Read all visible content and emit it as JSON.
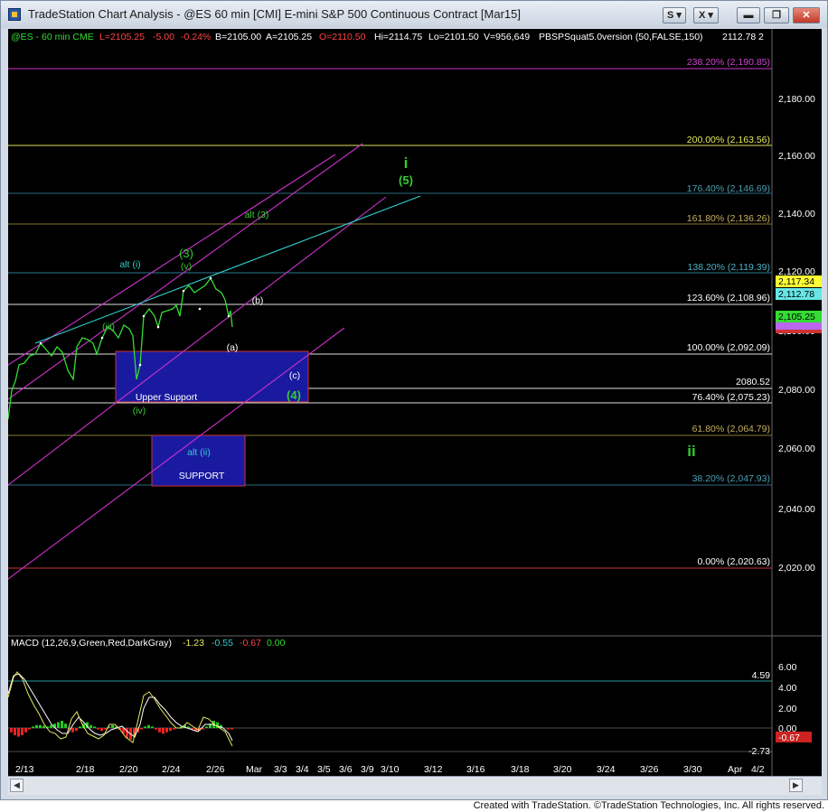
{
  "window": {
    "title": "TradeStation Chart Analysis - @ES 60 min [CMI] E-mini S&P 500 Continuous Contract [Mar15]",
    "buttons": {
      "s_label": "S",
      "x_label": "X",
      "minimize_label": "▬",
      "restore_label": "❐",
      "close_label": "✕"
    }
  },
  "header": {
    "symbol": "@ES - 60 min  CME",
    "last": "L=2105.25",
    "change": "-5.00",
    "change_pct": "-0.24%",
    "bid": "B=2105.00",
    "ask": "A=2105.25",
    "open": "O=2110.50",
    "high": "Hi=2114.75",
    "low": "Lo=2101.50",
    "volume": "V=956,649",
    "study": "PBSPSquat5.0version (50,FALSE,150)",
    "study_value": "2112.78",
    "study_extra": "2"
  },
  "price_axis": {
    "ticks": [
      "2,180.00",
      "2,160.00",
      "2,140.00",
      "2,120.00",
      "2,100.00",
      "2,080.00",
      "2,060.00",
      "2,040.00",
      "2,020.00"
    ],
    "tags": {
      "yellow": "2,117.34",
      "cyan": "2,112.78",
      "green": "2,105.25",
      "purple": ""
    }
  },
  "fib_levels": [
    {
      "label": "238.20% (2,190.85)"
    },
    {
      "label": "200.00% (2,163.56)"
    },
    {
      "label": "176.40% (2,146.69)"
    },
    {
      "label": "161.80% (2,136.26)"
    },
    {
      "label": "138.20% (2,119.39)"
    },
    {
      "label": "123.60% (2,108.96)"
    },
    {
      "label": "100.00% (2,092.09)"
    },
    {
      "label": "2080.52"
    },
    {
      "label": "76.40% (2,075.23)"
    },
    {
      "label": "61.80% (2,064.79)"
    },
    {
      "label": "38.20% (2,047.93)"
    },
    {
      "label": "0.00% (2,020.63)"
    }
  ],
  "annotations": {
    "wave_i": "i",
    "wave_5": "(5)",
    "alt_3": "alt (3)",
    "wave_3": "(3)",
    "wave_v": "(v)",
    "alt_i": "alt (i)",
    "wave_iii": "(iii)",
    "wave_b": "(b)",
    "wave_a": "(a)",
    "wave_c": "(c)",
    "wave_4": "(4)",
    "upper_support": "Upper Support",
    "wave_iv": "(iv)",
    "alt_ii": "alt (ii)",
    "support": "SUPPORT",
    "wave_ii": "ii"
  },
  "macd": {
    "label": "MACD (12,26,9,Green,Red,DarkGray)",
    "v1": "-1.23",
    "v2": "-0.55",
    "v3": "-0.67",
    "v4": "0.00",
    "axis_ticks": [
      "6.00",
      "4.00",
      "2.00",
      "0.00"
    ],
    "level_label": "4.59",
    "low_label": "-2.73",
    "current_tag": "-0.67"
  },
  "time_axis": {
    "labels": [
      "2/13",
      "2/18",
      "2/20",
      "2/24",
      "2/26",
      "Mar",
      "3/3",
      "3/4",
      "3/5",
      "3/6",
      "3/9",
      "3/10",
      "3/12",
      "3/16",
      "3/18",
      "3/20",
      "3/24",
      "3/26",
      "3/30",
      "Apr",
      "4/2"
    ]
  },
  "footer": {
    "text": "Created with TradeStation. ©TradeStation Technologies, Inc. All rights reserved."
  },
  "colors": {
    "price_line": "#33dd33",
    "channel": "#cc33cc",
    "trendline": "#33cccc",
    "support_box": "#1a1aa0"
  }
}
